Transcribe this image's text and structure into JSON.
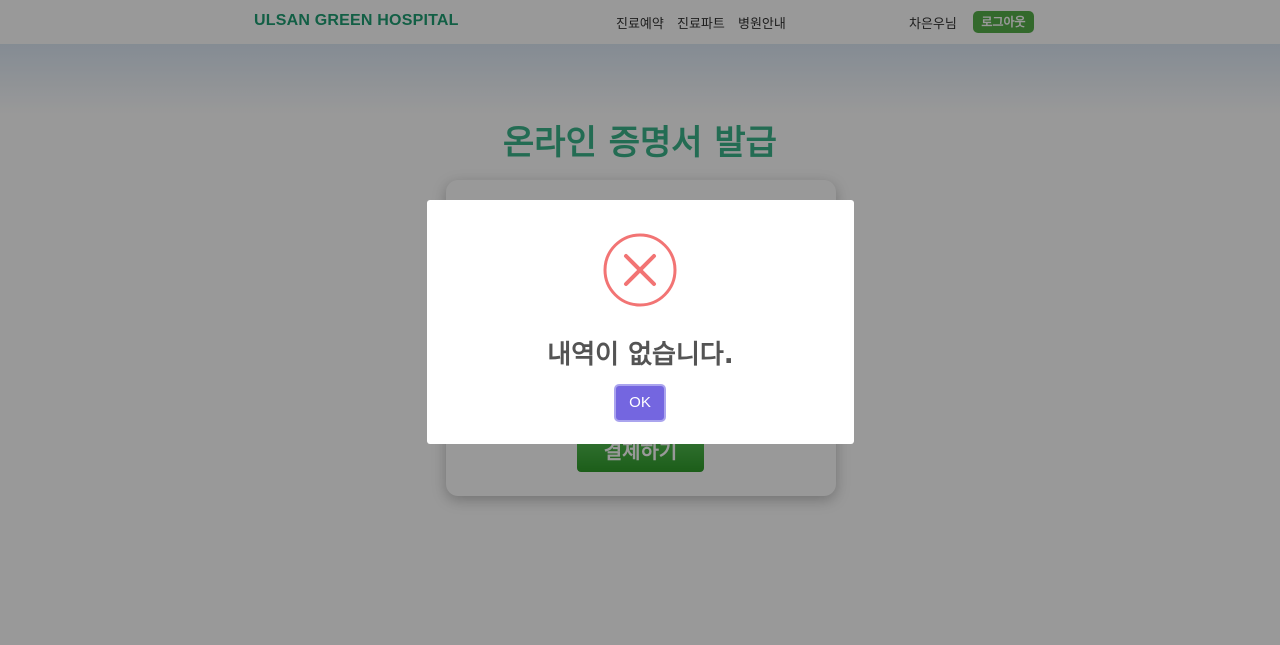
{
  "header": {
    "logo_text": "ULSAN GREEN HOSPITAL",
    "nav": [
      {
        "label": "진료예약"
      },
      {
        "label": "진료파트"
      },
      {
        "label": "병원안내"
      }
    ],
    "user_name": "차은우님",
    "logout_label": "로그아웃"
  },
  "main": {
    "page_title": "온라인 증명서 발급",
    "pay_button_label": "결제하기"
  },
  "modal": {
    "icon": "error-x-icon",
    "message": "내역이 없습니다.",
    "ok_label": "OK"
  },
  "colors": {
    "brand_green": "#1e9e74",
    "title_green": "#3bb58a",
    "button_green": "#56b04a",
    "error_red": "#f27474",
    "ok_purple": "#7466e0"
  }
}
